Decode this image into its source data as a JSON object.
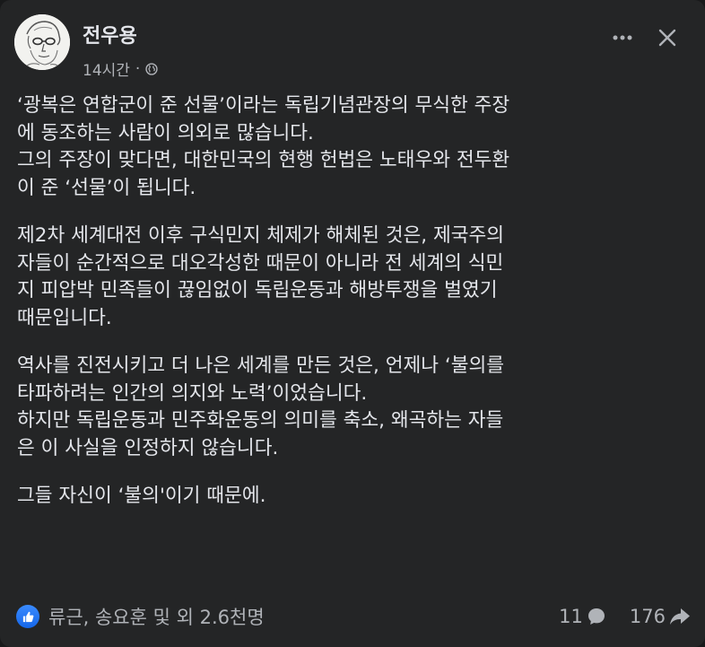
{
  "post": {
    "author": "전우용",
    "time": "14시간",
    "separator": "·",
    "paragraphs": [
      {
        "lines": [
          "‘광복은 연합군이 준 선물’이라는 독립기념관장의 무식한 주장",
          "에 동조하는 사람이 의외로 많습니다.",
          "그의 주장이 맞다면, 대한민국의 현행 헌법은 노태우와 전두환",
          "이 준 ‘선물’이 됩니다."
        ]
      },
      {
        "lines": [
          "제2차 세계대전 이후 구식민지 체제가 해체된 것은, 제국주의",
          "자들이 순간적으로 대오각성한 때문이 아니라 전 세계의 식민",
          "지 피압박 민족들이 끊임없이 독립운동과 해방투쟁을 벌였기",
          "때문입니다."
        ]
      },
      {
        "lines": [
          "역사를 진전시키고 더 나은 세계를 만든 것은, 언제나 ‘불의를",
          "타파하려는 인간의 의지와 노력’이었습니다.",
          "하지만 독립운동과 민주화운동의 의미를 축소, 왜곡하는 자들",
          "은 이 사실을 인정하지 않습니다."
        ]
      },
      {
        "lines": [
          "그들 자신이 ‘불의'이기 때문에."
        ]
      }
    ]
  },
  "footer": {
    "reactions_text": "류근, 송요훈 및 외 2.6천명",
    "comments_count": "11",
    "shares_count": "176"
  },
  "icons": {
    "audience": "globe-icon",
    "more": "more-horizontal-icon",
    "close": "close-icon",
    "reaction": "like-icon",
    "comments": "comment-icon",
    "shares": "share-icon"
  },
  "colors": {
    "card_bg": "#242526",
    "text_primary": "#e4e6eb",
    "text_secondary": "#b0b3b8",
    "like_blue": "#1877f2"
  }
}
